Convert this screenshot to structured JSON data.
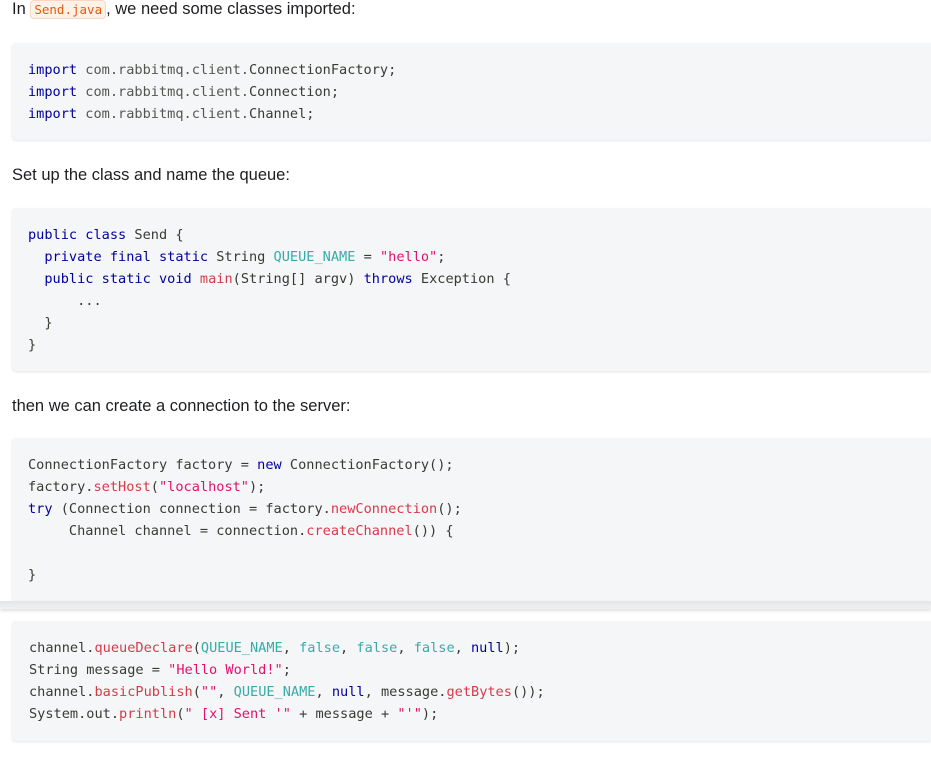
{
  "intro": {
    "prefix": "In ",
    "filename": "Send.java",
    "suffix": ", we need some classes imported:"
  },
  "imports": [
    {
      "kw": "import",
      "pkg": "com.rabbitmq.client.",
      "cls": "ConnectionFactory",
      "end": ";"
    },
    {
      "kw": "import",
      "pkg": "com.rabbitmq.client.",
      "cls": "Connection",
      "end": ";"
    },
    {
      "kw": "import",
      "pkg": "com.rabbitmq.client.",
      "cls": "Channel",
      "end": ";"
    }
  ],
  "para2": "Set up the class and name the queue:",
  "class_code": {
    "l1_kw": "public class",
    "l1_rest": " Send {",
    "l2_kw": "private final static",
    "l2_type": " String ",
    "l2_const": "QUEUE_NAME",
    "l2_eq": " = ",
    "l2_str": "\"hello\"",
    "l2_end": ";",
    "l3_kw": "public static void",
    "l3_fn": "main",
    "l3_args": "(String[] argv) ",
    "l3_kw2": "throws",
    "l3_rest": " Exception {",
    "l4": "...",
    "l5": "}",
    "l6": "}"
  },
  "para3": "then we can create a connection to the server:",
  "conn_code": {
    "l1_a": "ConnectionFactory factory = ",
    "l1_kw": "new",
    "l1_b": " ConnectionFactory();",
    "l2_a": "factory.",
    "l2_fn": "setHost",
    "l2_b": "(",
    "l2_str": "\"localhost\"",
    "l2_c": ");",
    "l3_kw": "try",
    "l3_a": " (Connection connection = factory.",
    "l3_fn": "newConnection",
    "l3_b": "();",
    "l4_a": "Channel channel = connection.",
    "l4_fn": "createChannel",
    "l4_b": "()) {",
    "l6": "}"
  },
  "publish_code": {
    "l1_a": "channel.",
    "l1_fn": "queueDeclare",
    "l1_b": "(",
    "l1_const": "QUEUE_NAME",
    "l1_c": ", ",
    "l1_f1": "false",
    "l1_d": ", ",
    "l1_f2": "false",
    "l1_e": ", ",
    "l1_f3": "false",
    "l1_f": ", ",
    "l1_null": "null",
    "l1_g": ");",
    "l2_a": "String message = ",
    "l2_str": "\"Hello World!\"",
    "l2_b": ";",
    "l3_a": "channel.",
    "l3_fn": "basicPublish",
    "l3_b": "(",
    "l3_str": "\"\"",
    "l3_c": ", ",
    "l3_const": "QUEUE_NAME",
    "l3_d": ", ",
    "l3_null": "null",
    "l3_e": ", message.",
    "l3_fn2": "getBytes",
    "l3_f": "());",
    "l4_a": "System.out.",
    "l4_fn": "println",
    "l4_b": "(",
    "l4_str": "\" [x] Sent '\"",
    "l4_c": " + message + ",
    "l4_str2": "\"'\"",
    "l4_d": ");"
  },
  "colors": {
    "keyword": "#00009f",
    "function": "#d73a49",
    "string": "#e3116c",
    "constant": "#36acaa",
    "code_bg": "#f5f6f7"
  }
}
